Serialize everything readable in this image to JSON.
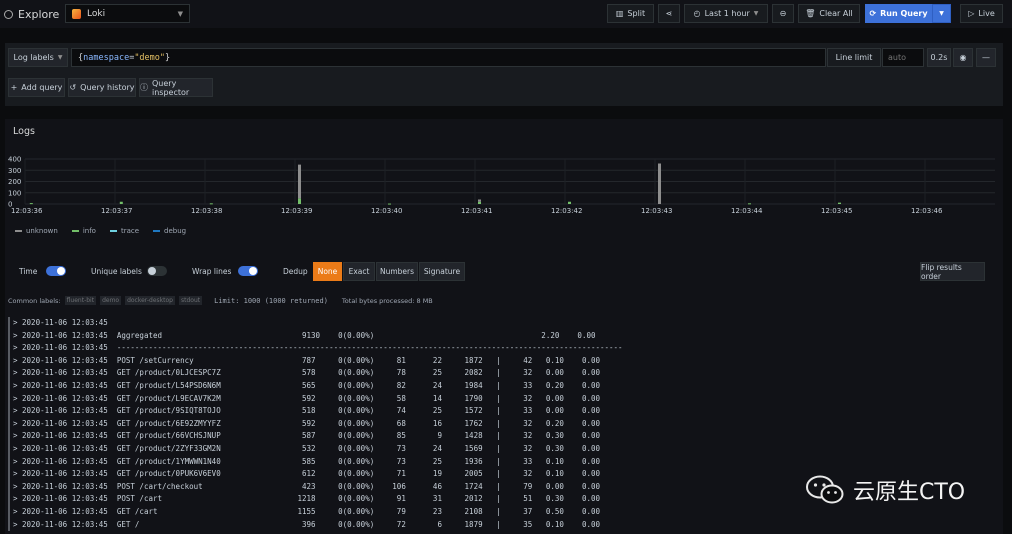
{
  "topbar": {
    "title": "Explore",
    "datasource": "Loki",
    "split": "Split",
    "time_range": "Last 1 hour",
    "clear_all": "Clear All",
    "run_query": "Run Query",
    "live": "Live"
  },
  "query": {
    "log_labels": "Log labels",
    "brace_open": "{",
    "key": "namespace",
    "eq": "=",
    "value": "\"demo\"",
    "brace_close": "}",
    "line_limit_label": "Line limit",
    "line_limit_placeholder": "auto",
    "duration": "0.2s",
    "add_query": "Add query",
    "query_history": "Query history",
    "query_inspector": "Query inspector"
  },
  "logs": {
    "title": "Logs",
    "legend": [
      {
        "name": "unknown",
        "color": "#8e8e8e"
      },
      {
        "name": "info",
        "color": "#73bf69"
      },
      {
        "name": "trace",
        "color": "#6ed0e0"
      },
      {
        "name": "debug",
        "color": "#1f78c1"
      }
    ],
    "options": {
      "time": "Time",
      "unique_labels": "Unique labels",
      "wrap_lines": "Wrap lines",
      "dedup": "Dedup",
      "dedup_options": [
        "None",
        "Exact",
        "Numbers",
        "Signature"
      ],
      "dedup_selected": "None",
      "flip": "Flip results order",
      "time_on": true,
      "unique_labels_on": false,
      "wrap_lines_on": true
    },
    "common_labels_label": "Common labels:",
    "common_labels": [
      "fluent-bit",
      "demo",
      "docker-desktop",
      "stdout"
    ],
    "limit_text": "Limit: 1000 (1000 returned)",
    "bytes_text": "Total bytes processed: 8 MB",
    "lines": [
      "> 2020-11-06 12:03:45",
      "> 2020-11-06 12:03:45  Aggregated                               9130    0(0.00%)                                     2.20    0.00",
      "> 2020-11-06 12:03:45  ----------------------------------------------------------------------------------------------------------------",
      "> 2020-11-06 12:03:45  POST /setCurrency                        787     0(0.00%)     81      22     1872   |     42   0.10    0.00",
      "> 2020-11-06 12:03:45  GET /product/0LJCESPC7Z                  578     0(0.00%)     78      25     2082   |     32   0.00    0.00",
      "> 2020-11-06 12:03:45  GET /product/L54PSD6N6M                  565     0(0.00%)     82      24     1984   |     33   0.20    0.00",
      "> 2020-11-06 12:03:45  GET /product/L9ECAV7K2M                  592     0(0.00%)     58      14     1790   |     32   0.00    0.00",
      "> 2020-11-06 12:03:45  GET /product/9SIQT8TOJO                  518     0(0.00%)     74      25     1572   |     33   0.00    0.00",
      "> 2020-11-06 12:03:45  GET /product/6E92ZMYYFZ                  592     0(0.00%)     68      16     1762   |     32   0.20    0.00",
      "> 2020-11-06 12:03:45  GET /product/66VCHSJNUP                  587     0(0.00%)     85       9     1428   |     32   0.30    0.00",
      "> 2020-11-06 12:03:45  GET /product/2ZYF33GM2N                  532     0(0.00%)     73      24     1569   |     32   0.30    0.00",
      "> 2020-11-06 12:03:45  GET /product/1YMWWN1N40                  585     0(0.00%)     73      25     1936   |     33   0.10    0.00",
      "> 2020-11-06 12:03:45  GET /product/0PUK6V6EV0                  612     0(0.00%)     71      19     2005   |     32   0.10    0.00",
      "> 2020-11-06 12:03:45  POST /cart/checkout                      423     0(0.00%)    106      46     1724   |     79   0.00    0.00",
      "> 2020-11-06 12:03:45  POST /cart                              1218     0(0.00%)     91      31     2012   |     51   0.30    0.00",
      "> 2020-11-06 12:03:45  GET /cart                               1155     0(0.00%)     79      23     2108   |     37   0.50    0.00",
      "> 2020-11-06 12:03:45  GET /                                    396     0(0.00%)     72       6     1879   |     35   0.10    0.00"
    ]
  },
  "chart_data": {
    "type": "bar",
    "y_ticks": [
      0,
      100,
      200,
      300,
      400
    ],
    "ylim": [
      0,
      400
    ],
    "x_ticks": [
      "12:03:36",
      "12:03:37",
      "12:03:38",
      "12:03:39",
      "12:03:40",
      "12:03:41",
      "12:03:42",
      "12:03:43",
      "12:03:44",
      "12:03:45",
      "12:03:46"
    ],
    "bars": [
      {
        "t": 0.07,
        "unknown": 0,
        "info": 8,
        "trace": 0,
        "debug": 0
      },
      {
        "t": 1.07,
        "unknown": 0,
        "info": 20,
        "trace": 0,
        "debug": 0
      },
      {
        "t": 2.07,
        "unknown": 0,
        "info": 6,
        "trace": 0,
        "debug": 0
      },
      {
        "t": 3.05,
        "unknown": 300,
        "info": 50,
        "trace": 0,
        "debug": 0
      },
      {
        "t": 4.05,
        "unknown": 0,
        "info": 4,
        "trace": 0,
        "debug": 0
      },
      {
        "t": 5.05,
        "unknown": 20,
        "info": 20,
        "trace": 0,
        "debug": 0
      },
      {
        "t": 6.05,
        "unknown": 0,
        "info": 20,
        "trace": 0,
        "debug": 0
      },
      {
        "t": 7.05,
        "unknown": 360,
        "info": 0,
        "trace": 0,
        "debug": 0
      },
      {
        "t": 8.05,
        "unknown": 0,
        "info": 6,
        "trace": 0,
        "debug": 0
      },
      {
        "t": 9.05,
        "unknown": 0,
        "info": 12,
        "trace": 0,
        "debug": 0
      }
    ]
  },
  "watermark": {
    "text": "云原生CTO"
  }
}
